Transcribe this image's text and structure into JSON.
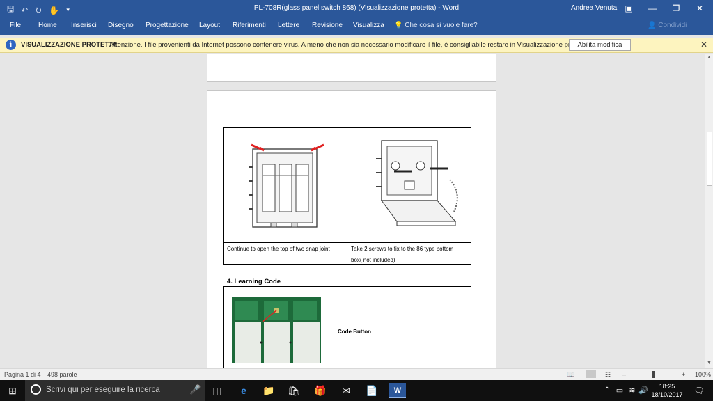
{
  "window": {
    "title": "PL-708R(glass panel switch 868) (Visualizzazione protetta)  -  Word",
    "user": "Andrea Venuta"
  },
  "ribbon": {
    "tabs": [
      "File",
      "Home",
      "Inserisci",
      "Disegno",
      "Progettazione",
      "Layout",
      "Riferimenti",
      "Lettere",
      "Revisione",
      "Visualizza"
    ],
    "tell_me": "Che cosa si vuole fare?",
    "share": "Condividi"
  },
  "protected_view": {
    "label": "VISUALIZZAZIONE PROTETTA",
    "message": "Attenzione. I file provenienti da Internet possono contenere virus. A meno che non sia necessario modificare il file, è consigliabile restare in Visualizzazione protetta.",
    "enable_button": "Abilita modifica"
  },
  "document": {
    "install_table": {
      "left_caption": "Continue to open the top of two snap joint",
      "right_caption_line1": "Take  2  screws  to  fix  to  the  86  type  bottom",
      "right_caption_line2": "box( not included)"
    },
    "section_heading": "4. Learning Code",
    "code_table": {
      "label": "Code Button"
    }
  },
  "status_bar": {
    "page": "Pagina 1 di 4",
    "words": "498 parole",
    "zoom": "100%"
  },
  "taskbar": {
    "search_placeholder": "Scrivi qui per eseguire la ricerca",
    "time": "18:25",
    "date": "18/10/2017"
  },
  "colors": {
    "word_blue": "#2b579a",
    "protected_bar": "#fdf4bf",
    "arrow_red": "#e02020"
  }
}
